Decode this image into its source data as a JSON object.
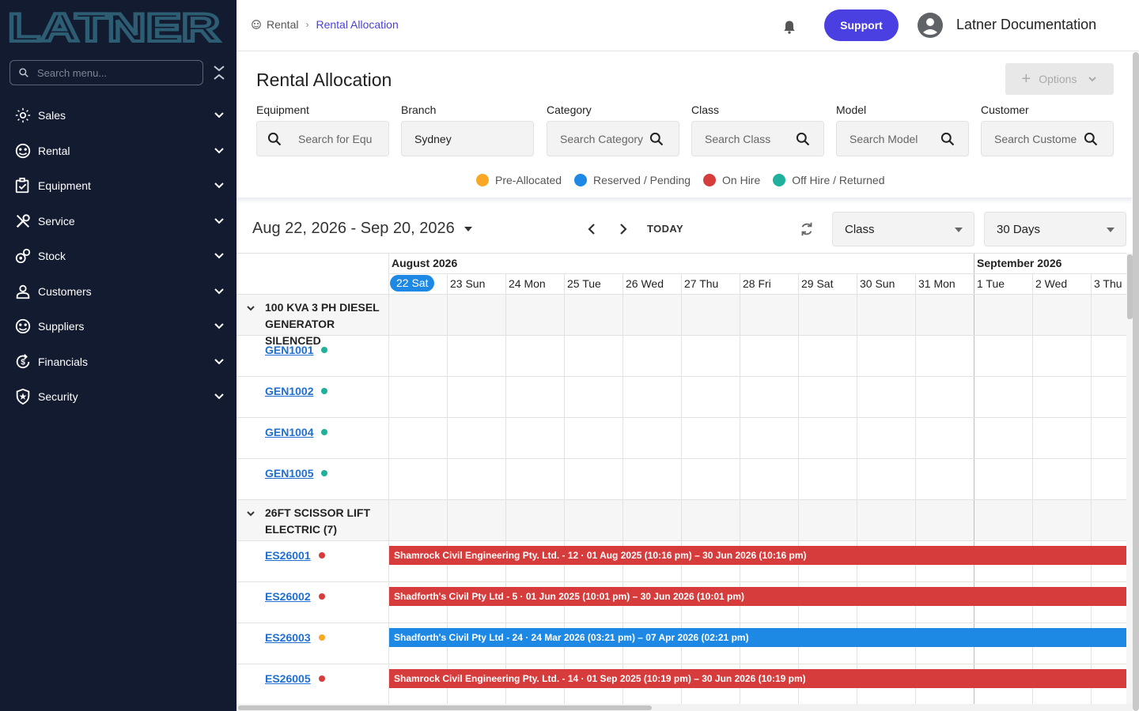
{
  "sidebar": {
    "logo_text": "LATNER",
    "search_placeholder": "Search menu...",
    "items": [
      {
        "label": "Sales",
        "icon": "sales-icon"
      },
      {
        "label": "Rental",
        "icon": "rental-icon"
      },
      {
        "label": "Equipment",
        "icon": "equipment-icon"
      },
      {
        "label": "Service",
        "icon": "service-icon"
      },
      {
        "label": "Stock",
        "icon": "stock-icon"
      },
      {
        "label": "Customers",
        "icon": "customers-icon"
      },
      {
        "label": "Suppliers",
        "icon": "suppliers-icon"
      },
      {
        "label": "Financials",
        "icon": "financials-icon"
      },
      {
        "label": "Security",
        "icon": "security-icon"
      }
    ]
  },
  "header": {
    "breadcrumb_root": "Rental",
    "breadcrumb_current": "Rental Allocation",
    "support_label": "Support",
    "user_name": "Latner Documentation"
  },
  "filters": {
    "title": "Rental Allocation",
    "options_label": "Options",
    "equipment": {
      "label": "Equipment",
      "placeholder": "Search for Equ"
    },
    "branch": {
      "label": "Branch",
      "value": "Sydney"
    },
    "category": {
      "label": "Category",
      "placeholder": "Search Category"
    },
    "class": {
      "label": "Class",
      "placeholder": "Search Class"
    },
    "model": {
      "label": "Model",
      "placeholder": "Search Model"
    },
    "customer": {
      "label": "Customer",
      "placeholder": "Search Custome"
    }
  },
  "legend": [
    {
      "label": "Pre-Allocated",
      "color": "#f9a825"
    },
    {
      "label": "Reserved / Pending",
      "color": "#1e88e5"
    },
    {
      "label": "On Hire",
      "color": "#d63c3c"
    },
    {
      "label": "Off Hire / Returned",
      "color": "#1fb19b"
    }
  ],
  "toolbar": {
    "date_range": "Aug 22, 2026 - Sep 20, 2026",
    "today_label": "TODAY",
    "group_by": "Class",
    "period": "30 Days"
  },
  "calendar": {
    "months": [
      "August 2026",
      "September 2026"
    ],
    "days": [
      "22 Sat",
      "23 Sun",
      "24 Mon",
      "25 Tue",
      "26 Wed",
      "27 Thu",
      "28 Fri",
      "29 Sat",
      "30 Sun",
      "31 Mon",
      "1 Tue",
      "2 Wed",
      "3 Thu"
    ],
    "today_index": 0
  },
  "groups": [
    {
      "title": "100 KVA 3 PH DIESEL GENERATOR SILENCED",
      "units": [
        {
          "id": "GEN1001",
          "status_color": "#1fb19b",
          "booking": null
        },
        {
          "id": "GEN1002",
          "status_color": "#1fb19b",
          "booking": null
        },
        {
          "id": "GEN1004",
          "status_color": "#1fb19b",
          "booking": null
        },
        {
          "id": "GEN1005",
          "status_color": "#1fb19b",
          "booking": null
        }
      ]
    },
    {
      "title": "26FT SCISSOR LIFT ELECTRIC (7)",
      "units": [
        {
          "id": "ES26001",
          "status_color": "#d63c3c",
          "booking": {
            "text": "Shamrock Civil Engineering Pty. Ltd. - 12 · 01 Aug 2025 (10:16 pm) – 30 Jun 2026 (10:16 pm)",
            "color": "#d63c3c"
          }
        },
        {
          "id": "ES26002",
          "status_color": "#d63c3c",
          "booking": {
            "text": "Shadforth's Civil Pty Ltd - 5 · 01 Jun 2025 (10:01 pm) – 30 Jun 2026 (10:01 pm)",
            "color": "#d63c3c"
          }
        },
        {
          "id": "ES26003",
          "status_color": "#f9a825",
          "booking": {
            "text": "Shadforth's Civil Pty Ltd - 24 · 24 Mar 2026 (03:21 pm) – 07 Apr 2026 (02:21 pm)",
            "color": "#1e88e5"
          }
        },
        {
          "id": "ES26005",
          "status_color": "#d63c3c",
          "booking": {
            "text": "Shamrock Civil Engineering Pty. Ltd. - 14 · 01 Sep 2025 (10:19 pm) – 30 Jun 2026 (10:19 pm)",
            "color": "#d63c3c"
          }
        }
      ]
    }
  ]
}
